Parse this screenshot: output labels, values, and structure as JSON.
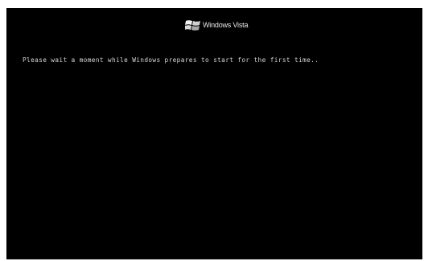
{
  "screen": {
    "logo": {
      "icon": "windows-flag-icon",
      "text": "Windows Vista"
    },
    "message": "Please wait a moment while Windows prepares to start for the first time..",
    "colors": {
      "background": "#000000",
      "text": "#d8d8d8",
      "border": "#ffffff"
    }
  }
}
